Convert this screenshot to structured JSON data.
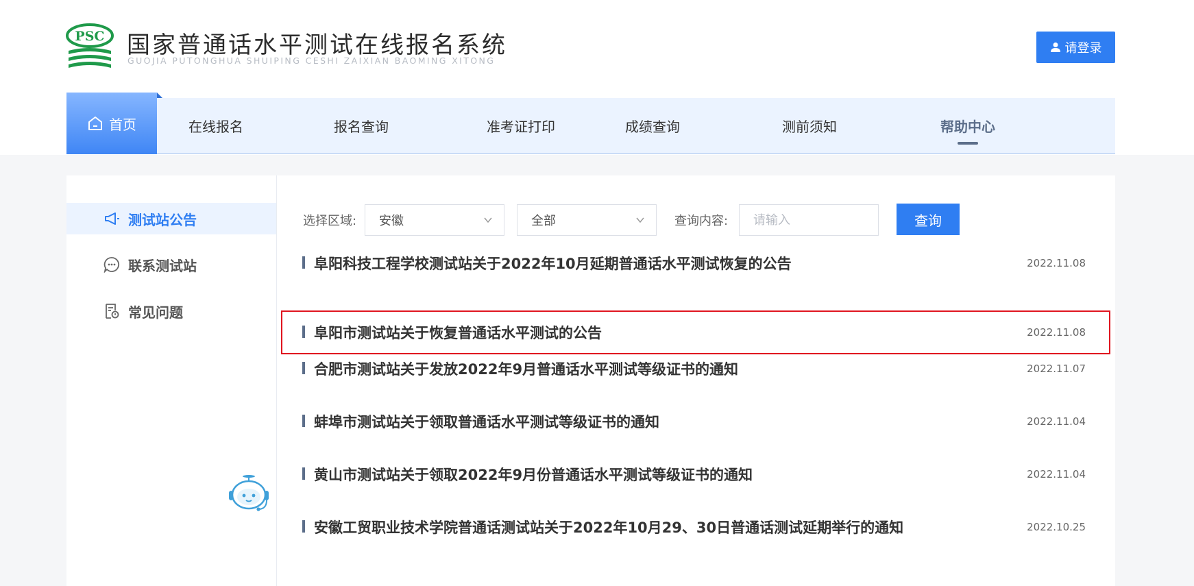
{
  "header": {
    "logo_text": "PSC",
    "title": "国家普通话水平测试在线报名系统",
    "subtitle": "GUOJIA PUTONGHUA SHUIPING CESHI ZAIXIAN BAOMING XITONG",
    "login_label": "请登录"
  },
  "nav": {
    "home": "首页",
    "items": [
      "在线报名",
      "报名查询",
      "准考证打印",
      "成绩查询",
      "测前须知",
      "帮助中心"
    ],
    "active": "帮助中心"
  },
  "sidebar": {
    "items": [
      {
        "label": "测试站公告",
        "icon": "megaphone-icon",
        "active": true
      },
      {
        "label": "联系测试站",
        "icon": "chat-icon",
        "active": false
      },
      {
        "label": "常见问题",
        "icon": "faq-document-icon",
        "active": false
      }
    ]
  },
  "filter": {
    "region_label": "选择区域:",
    "region_value": "安徽",
    "category_value": "全部",
    "query_label": "查询内容:",
    "query_placeholder": "请输入",
    "query_button": "查询"
  },
  "notices": [
    {
      "title": "阜阳科技工程学校测试站关于2022年10月延期普通话水平测试恢复的公告",
      "date": "2022.11.08"
    },
    {
      "title": "阜阳市测试站关于恢复普通话水平测试的公告",
      "date": "2022.11.08",
      "highlighted": true
    },
    {
      "title": "合肥市测试站关于发放2022年9月普通话水平测试等级证书的通知",
      "date": "2022.11.07"
    },
    {
      "title": "蚌埠市测试站关于领取普通话水平测试等级证书的通知",
      "date": "2022.11.04"
    },
    {
      "title": "黄山市测试站关于领取2022年9月份普通话水平测试等级证书的通知",
      "date": "2022.11.04"
    },
    {
      "title": "安徽工贸职业技术学院普通话测试站关于2022年10月29、30日普通话测试延期举行的通知",
      "date": "2022.10.25"
    }
  ],
  "colors": {
    "accent": "#2f7ef2",
    "highlight_border": "#e0151f",
    "logo_green": "#1f9a4a"
  }
}
